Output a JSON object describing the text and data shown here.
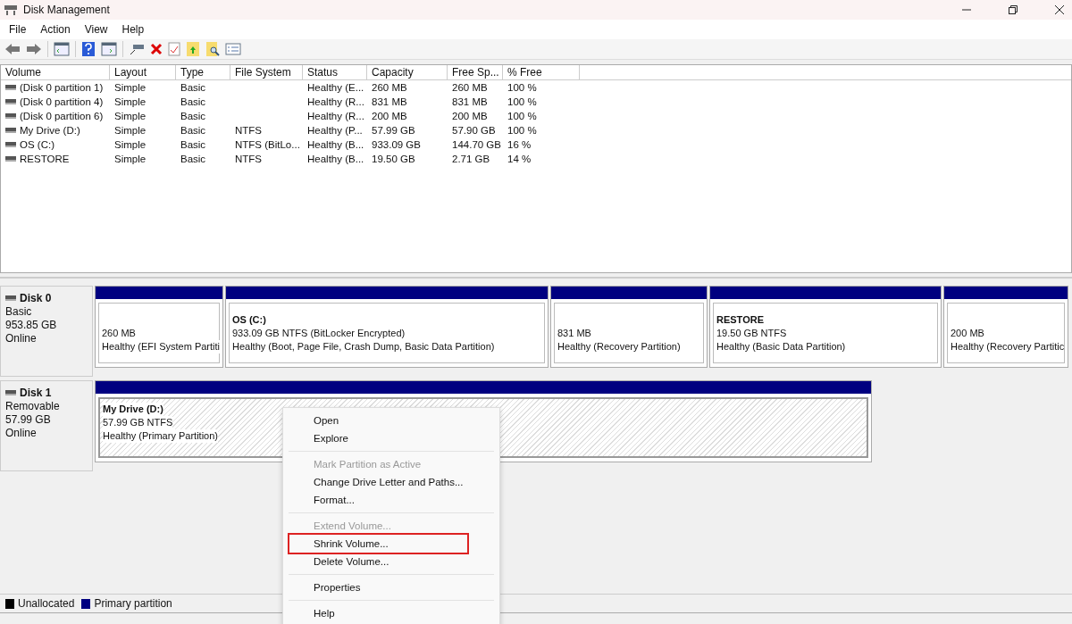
{
  "window": {
    "title": "Disk Management"
  },
  "menu": [
    "File",
    "Action",
    "View",
    "Help"
  ],
  "table": {
    "columns": [
      "Volume",
      "Layout",
      "Type",
      "File System",
      "Status",
      "Capacity",
      "Free Sp...",
      "% Free"
    ],
    "rows": [
      {
        "cells": [
          "(Disk 0 partition 1)",
          "Simple",
          "Basic",
          "",
          "Healthy (E...",
          "260 MB",
          "260 MB",
          "100 %"
        ]
      },
      {
        "cells": [
          "(Disk 0 partition 4)",
          "Simple",
          "Basic",
          "",
          "Healthy (R...",
          "831 MB",
          "831 MB",
          "100 %"
        ]
      },
      {
        "cells": [
          "(Disk 0 partition 6)",
          "Simple",
          "Basic",
          "",
          "Healthy (R...",
          "200 MB",
          "200 MB",
          "100 %"
        ]
      },
      {
        "cells": [
          "My Drive (D:)",
          "Simple",
          "Basic",
          "NTFS",
          "Healthy (P...",
          "57.99 GB",
          "57.90 GB",
          "100 %"
        ]
      },
      {
        "cells": [
          "OS (C:)",
          "Simple",
          "Basic",
          "NTFS (BitLo...",
          "Healthy (B...",
          "933.09 GB",
          "144.70 GB",
          "16 %"
        ]
      },
      {
        "cells": [
          "RESTORE",
          "Simple",
          "Basic",
          "NTFS",
          "Healthy (B...",
          "19.50 GB",
          "2.71 GB",
          "14 %"
        ]
      }
    ]
  },
  "disks": [
    {
      "name": "Disk 0",
      "type": "Basic",
      "size": "953.85 GB",
      "status": "Online",
      "partitions": [
        {
          "size": "260 MB",
          "status": "Healthy (EFI System Partiti",
          "selected": false
        },
        {
          "name": "OS  (C:)",
          "size": "933.09 GB NTFS (BitLocker Encrypted)",
          "status": "Healthy (Boot, Page File, Crash Dump, Basic Data Partition)",
          "selected": false
        },
        {
          "size": "831 MB",
          "status": "Healthy (Recovery Partition)",
          "selected": false
        },
        {
          "name": "RESTORE",
          "size": "19.50 GB NTFS",
          "status": "Healthy (Basic Data Partition)",
          "selected": false
        },
        {
          "size": "200 MB",
          "status": "Healthy (Recovery Partitic",
          "selected": false
        }
      ]
    },
    {
      "name": "Disk 1",
      "type": "Removable",
      "size": "57.99 GB",
      "status": "Online",
      "partitions": [
        {
          "name": "My Drive  (D:)",
          "size": "57.99 GB NTFS",
          "status": "Healthy (Primary Partition)",
          "selected": true
        }
      ]
    }
  ],
  "context_menu": [
    {
      "label": "Open",
      "disabled": false,
      "highlighted": false,
      "separator_after": false
    },
    {
      "label": "Explore",
      "disabled": false,
      "highlighted": false,
      "separator_after": true
    },
    {
      "label": "Mark Partition as Active",
      "disabled": true,
      "highlighted": false,
      "separator_after": false
    },
    {
      "label": "Change Drive Letter and Paths...",
      "disabled": false,
      "highlighted": false,
      "separator_after": false
    },
    {
      "label": "Format...",
      "disabled": false,
      "highlighted": false,
      "separator_after": true
    },
    {
      "label": "Extend Volume...",
      "disabled": true,
      "highlighted": false,
      "separator_after": false
    },
    {
      "label": "Shrink Volume...",
      "disabled": false,
      "highlighted": true,
      "separator_after": false
    },
    {
      "label": "Delete Volume...",
      "disabled": false,
      "highlighted": false,
      "separator_after": true
    },
    {
      "label": "Properties",
      "disabled": false,
      "highlighted": false,
      "separator_after": true
    },
    {
      "label": "Help",
      "disabled": false,
      "highlighted": false,
      "separator_after": false
    }
  ],
  "legend": [
    {
      "label": "Unallocated",
      "color": "#000000"
    },
    {
      "label": "Primary partition",
      "color": "#000080"
    }
  ]
}
